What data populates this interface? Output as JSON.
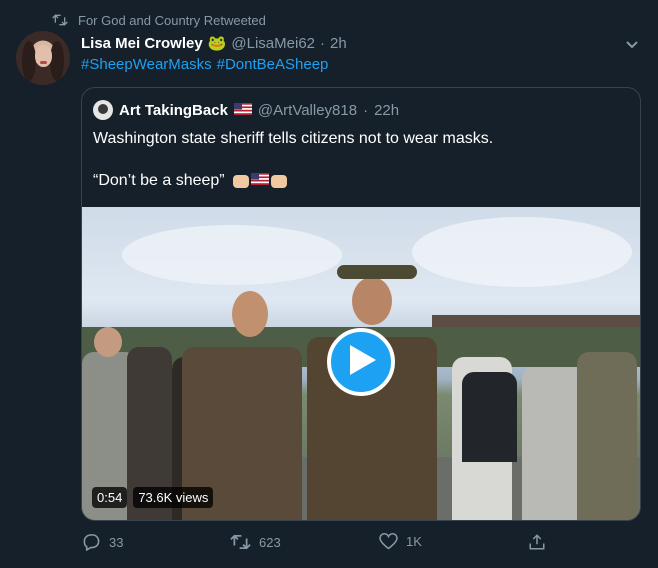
{
  "retweet": {
    "icon": "retweet-icon",
    "text": "For God and Country Retweeted"
  },
  "author": {
    "display_name": "Lisa Mei Crowley",
    "emoji": "🐸",
    "handle": "@LisaMei62",
    "separator": "·",
    "time": "2h"
  },
  "tweet": {
    "hashtags": [
      "#SheepWearMasks",
      "#DontBeASheep"
    ]
  },
  "quote": {
    "display_name": "Art TakingBack",
    "flag_icon": "us-flag-icon",
    "handle": "@ArtValley818",
    "separator": "·",
    "time": "22h",
    "line1": "Washington state sheriff tells citizens not to wear masks.",
    "line2": "“Don’t be a sheep”",
    "emojis": [
      "fist-icon",
      "us-flag-icon",
      "fist-icon"
    ],
    "video": {
      "duration": "0:54",
      "views": "73.6K views",
      "play_icon": "play-icon"
    }
  },
  "actions": {
    "reply": {
      "icon": "reply-icon",
      "count": "33"
    },
    "retweet": {
      "icon": "retweet-icon",
      "count": "623"
    },
    "like": {
      "icon": "heart-icon",
      "count": "1K"
    },
    "share": {
      "icon": "share-icon"
    }
  },
  "colors": {
    "background": "#15202b",
    "accent": "#1da1f2",
    "muted": "#8899a6",
    "border": "#38444d"
  }
}
